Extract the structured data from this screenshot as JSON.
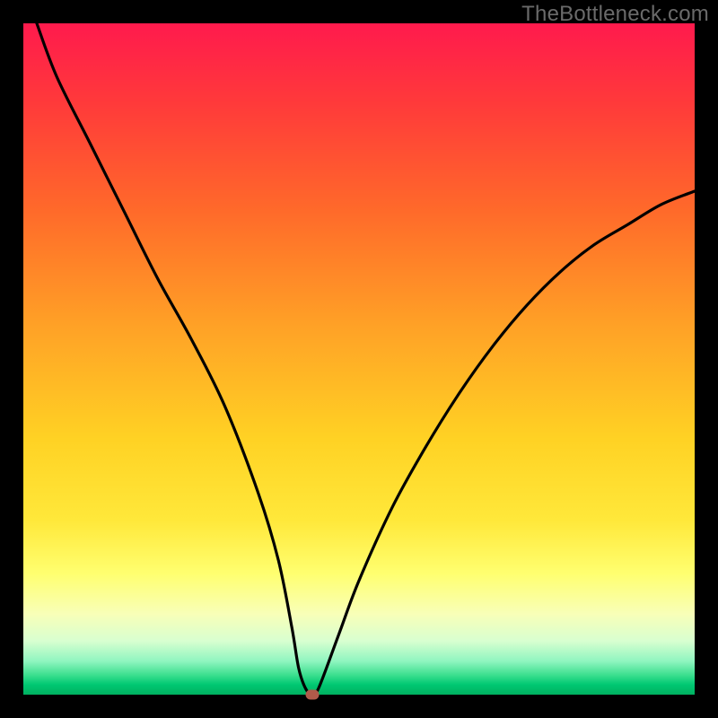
{
  "watermark": "TheBottleneck.com",
  "colors": {
    "page_bg": "#000000",
    "gradient_top": "#ff1a4d",
    "gradient_mid": "#ffd224",
    "gradient_bottom": "#00b060",
    "curve_stroke": "#000000",
    "marker_fill": "#b05a4a"
  },
  "chart_data": {
    "type": "line",
    "title": "",
    "xlabel": "",
    "ylabel": "",
    "xlim": [
      0,
      100
    ],
    "ylim": [
      0,
      100
    ],
    "grid": false,
    "legend": false,
    "series": [
      {
        "name": "bottleneck-curve",
        "x": [
          2,
          5,
          10,
          15,
          20,
          25,
          30,
          35,
          38,
          40,
          41,
          42,
          43,
          44,
          47,
          50,
          55,
          60,
          65,
          70,
          75,
          80,
          85,
          90,
          95,
          100
        ],
        "values": [
          100,
          92,
          82,
          72,
          62,
          53,
          43,
          30,
          20,
          10,
          4,
          1,
          0,
          1,
          9,
          17,
          28,
          37,
          45,
          52,
          58,
          63,
          67,
          70,
          73,
          75
        ]
      }
    ],
    "marker": {
      "x": 43,
      "y": 0
    },
    "gradient_stops": [
      {
        "pos": 0.0,
        "color": "#ff1a4d"
      },
      {
        "pos": 0.12,
        "color": "#ff3a3a"
      },
      {
        "pos": 0.28,
        "color": "#ff6a2a"
      },
      {
        "pos": 0.45,
        "color": "#ffa126"
      },
      {
        "pos": 0.62,
        "color": "#ffd224"
      },
      {
        "pos": 0.74,
        "color": "#ffe83a"
      },
      {
        "pos": 0.82,
        "color": "#ffff70"
      },
      {
        "pos": 0.88,
        "color": "#f8ffb8"
      },
      {
        "pos": 0.92,
        "color": "#d8ffd0"
      },
      {
        "pos": 0.95,
        "color": "#90f5c0"
      },
      {
        "pos": 0.97,
        "color": "#3fe090"
      },
      {
        "pos": 0.985,
        "color": "#00c872"
      },
      {
        "pos": 1.0,
        "color": "#00b060"
      }
    ]
  }
}
